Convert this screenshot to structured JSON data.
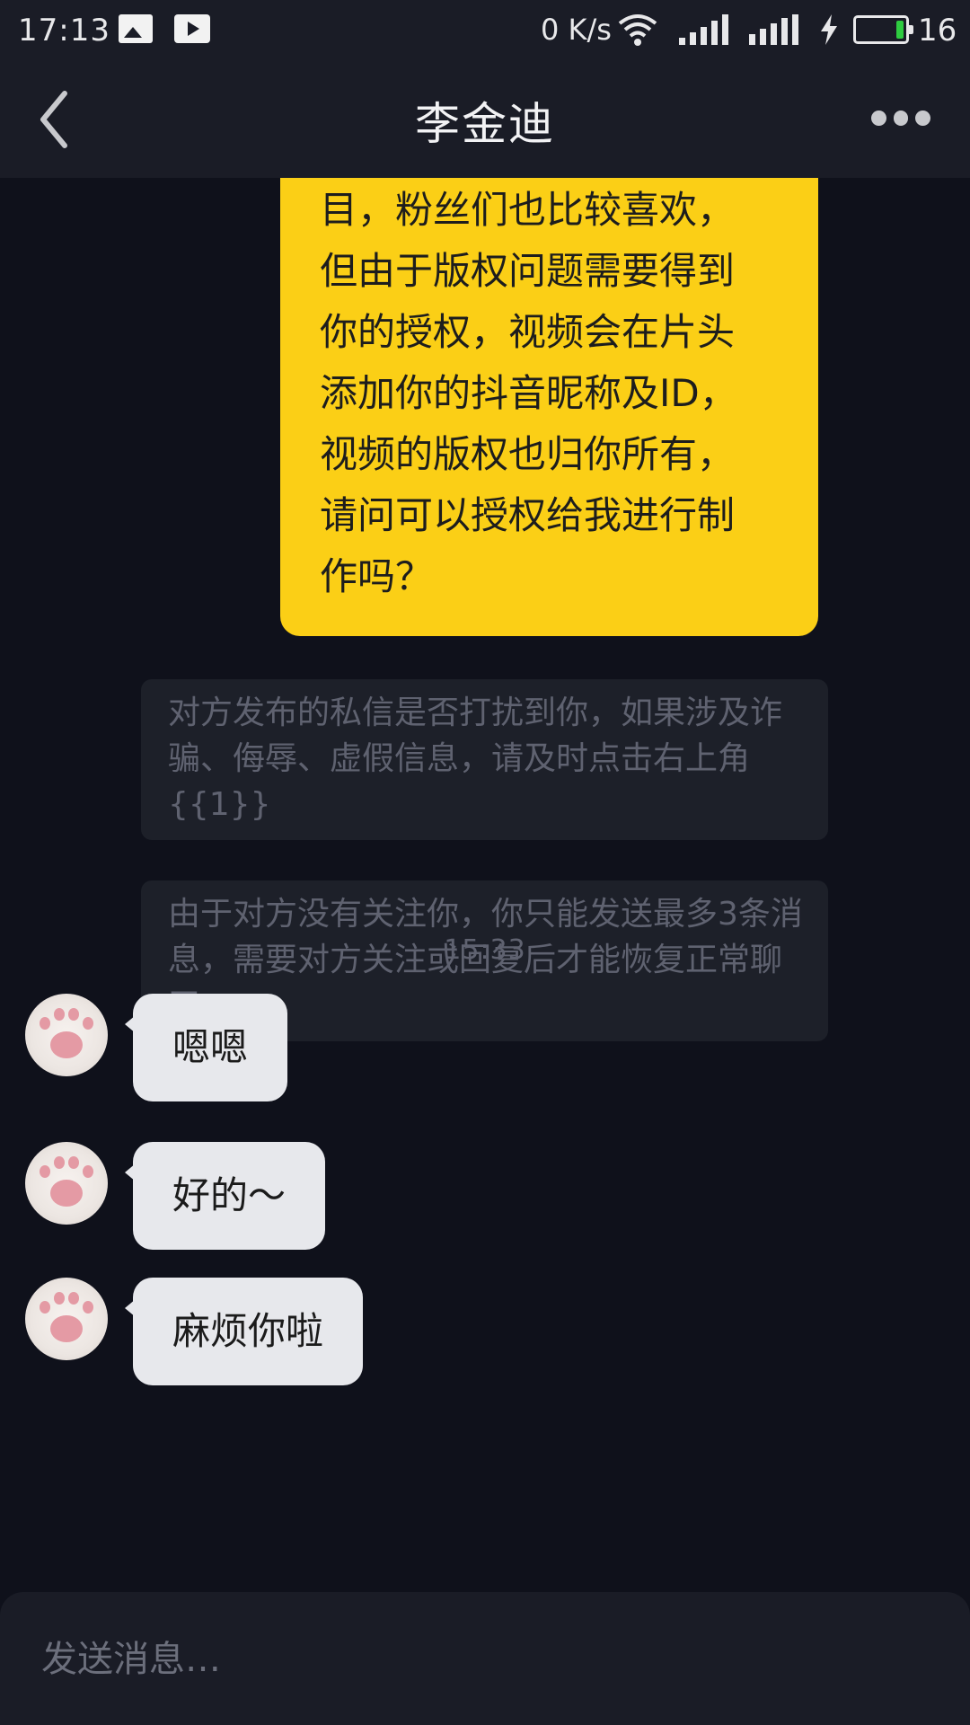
{
  "status_bar": {
    "time": "17:13",
    "speed": "0 K/s",
    "battery_pct": "16",
    "battery_level": 0.16,
    "battery_color": "#2ecc40",
    "icons": [
      "gallery-icon",
      "play-icon",
      "wifi-icon",
      "signal-icon",
      "4g-signal-icon",
      "charging-icon",
      "battery-icon"
    ]
  },
  "header": {
    "title": "李金迪",
    "back_icon": "chevron-left-icon",
    "more_icon": "more-dots-icon"
  },
  "messages": {
    "outgoing": {
      "lines": [
        "目，粉丝们也比较喜欢，",
        "但由于版权问题需要得到",
        "你的授权，视频会在片头",
        "添加你的抖音昵称及ID，",
        "视频的版权也归你所有，",
        "请问可以授权给我进行制",
        "作吗？"
      ],
      "color": "#fbcf16"
    },
    "notice_1": "对方发布的私信是否打扰到你，如果涉及诈骗、侮辱、虚假信息，请及时点击右上角{{1}}",
    "notice_2": "由于对方没有关注你，你只能发送最多3条消息，需要对方关注或回复后才能恢复正常聊天",
    "timestamp": "15:33",
    "incoming": [
      {
        "text": "嗯嗯"
      },
      {
        "text": "好的～"
      },
      {
        "text": "麻烦你啦"
      }
    ]
  },
  "input": {
    "placeholder": "发送消息…"
  }
}
